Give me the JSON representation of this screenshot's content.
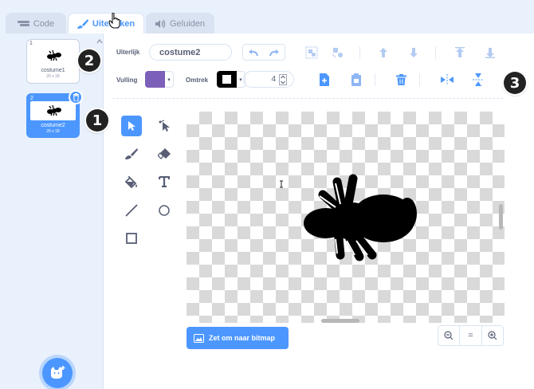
{
  "tabs": [
    {
      "label": "Code",
      "icon": "code-icon"
    },
    {
      "label": "Uiterlijken",
      "icon": "brush-icon"
    },
    {
      "label": "Geluiden",
      "icon": "sound-icon"
    }
  ],
  "costumes": [
    {
      "index": "1",
      "name": "costume1",
      "size": "26 x 18"
    },
    {
      "index": "2",
      "name": "costume2",
      "size": "26 x 18"
    }
  ],
  "markers": [
    "1",
    "2",
    "3"
  ],
  "toolbar": {
    "costume_label": "Uiterlijk",
    "costume_name": "costume2",
    "fill_label": "Vulling",
    "outline_label": "Omtrek",
    "stroke_width": "4",
    "fill_color": "#7c5fb8",
    "outline_color": "#000000"
  },
  "canvas": {
    "convert_button": "Zet om naar bitmap",
    "zoom_reset": "="
  },
  "colors": {
    "accent": "#4c97ff",
    "text": "#575e75",
    "panel": "#e9f1fc"
  }
}
